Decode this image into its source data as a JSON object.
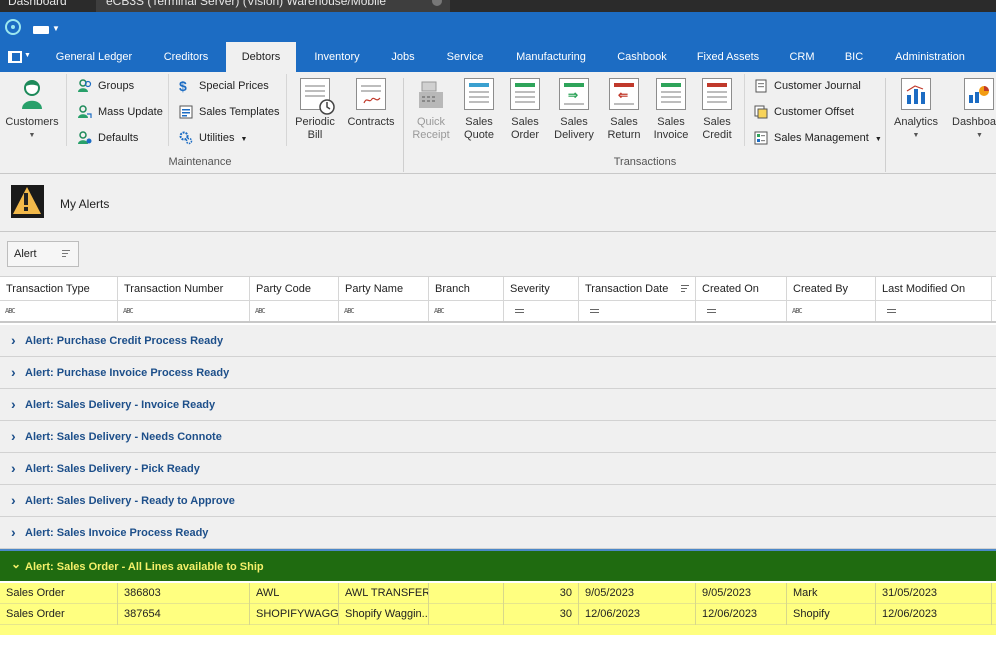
{
  "window": {
    "tabs": [
      "Dashboard",
      "eCB3S (Terminal Server) (Vision) Warehouse/Mobile"
    ]
  },
  "menu": {
    "tabs": [
      "General Ledger",
      "Creditors",
      "Debtors",
      "Inventory",
      "Jobs",
      "Service",
      "Manufacturing",
      "Cashbook",
      "Fixed Assets",
      "CRM",
      "BIC",
      "Administration"
    ],
    "active": "Debtors"
  },
  "ribbon": {
    "customers_label": "Customers",
    "groups_label": "Groups",
    "mass_update_label": "Mass Update",
    "defaults_label": "Defaults",
    "special_prices_label": "Special Prices",
    "sales_templates_label": "Sales Templates",
    "utilities_label": "Utilities",
    "periodic_bill_label": [
      "Periodic",
      "Bill"
    ],
    "contracts_label": "Contracts",
    "maintenance_group": "Maintenance",
    "quick_receipt_label": [
      "Quick",
      "Receipt"
    ],
    "sales_quote_label": [
      "Sales",
      "Quote"
    ],
    "sales_order_label": [
      "Sales",
      "Order"
    ],
    "sales_delivery_label": [
      "Sales",
      "Delivery"
    ],
    "sales_return_label": [
      "Sales",
      "Return"
    ],
    "sales_invoice_label": [
      "Sales",
      "Invoice"
    ],
    "sales_credit_label": [
      "Sales",
      "Credit"
    ],
    "customer_journal_label": "Customer Journal",
    "customer_offset_label": "Customer Offset",
    "sales_management_label": "Sales Management",
    "transactions_group": "Transactions",
    "analytics_label": "Analytics",
    "dashboards_label": "Dashboar"
  },
  "alerts": {
    "title": "My Alerts",
    "group_by_chip": "Alert"
  },
  "grid": {
    "columns": [
      "Transaction Type",
      "Transaction Number",
      "Party Code",
      "Party Name",
      "Branch",
      "Severity",
      "Transaction Date",
      "Created On",
      "Created By",
      "Last Modified On"
    ],
    "filter_types": [
      "text",
      "text",
      "text",
      "text",
      "text",
      "eq",
      "eq",
      "eq",
      "text",
      "eq"
    ],
    "abc_glyph": "ABC",
    "groups": [
      {
        "label": "Alert: Purchase Credit Process Ready",
        "expanded": false
      },
      {
        "label": "Alert: Purchase Invoice Process Ready",
        "expanded": false
      },
      {
        "label": "Alert: Sales Delivery - Invoice Ready",
        "expanded": false
      },
      {
        "label": "Alert: Sales Delivery - Needs Connote",
        "expanded": false
      },
      {
        "label": "Alert: Sales Delivery - Pick Ready",
        "expanded": false
      },
      {
        "label": "Alert: Sales Delivery - Ready to Approve",
        "expanded": false
      },
      {
        "label": "Alert: Sales Invoice Process Ready",
        "expanded": false
      },
      {
        "label": "Alert: Sales Order - All Lines available to Ship",
        "expanded": true
      }
    ],
    "rows": [
      [
        "Sales Order",
        "386803",
        "AWL",
        "AWL TRANSFER",
        "",
        "30",
        "9/05/2023",
        "9/05/2023",
        "Mark",
        "31/05/2023"
      ],
      [
        "Sales Order",
        "387654",
        "SHOPIFYWAGG...",
        "Shopify Waggin...",
        "",
        "30",
        "12/06/2023",
        "12/06/2023",
        "Shopify",
        "12/06/2023"
      ]
    ]
  }
}
